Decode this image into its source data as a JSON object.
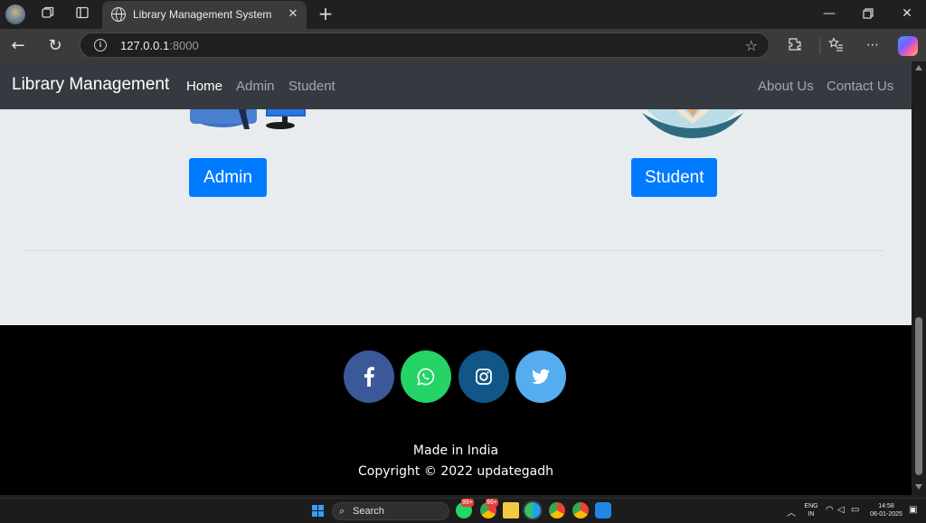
{
  "browser": {
    "tab_title": "Library Management System",
    "url_host": "127.0.0.1",
    "url_port": ":8000"
  },
  "site": {
    "brand": "Library Management",
    "nav_left": [
      "Home",
      "Admin",
      "Student"
    ],
    "nav_right": [
      "About Us",
      "Contact Us"
    ],
    "active_nav": "Home"
  },
  "main": {
    "admin_button": "Admin",
    "student_button": "Student"
  },
  "footer": {
    "social": [
      {
        "name": "facebook",
        "color": "#3b5998"
      },
      {
        "name": "whatsapp",
        "color": "#25d366"
      },
      {
        "name": "instagram",
        "color": "#125688"
      },
      {
        "name": "twitter",
        "color": "#55acee"
      }
    ],
    "made_in": "Made in India",
    "copyright": "Copyright © 2022 updategadh"
  },
  "taskbar": {
    "search_label": "Search",
    "badge_count": "99+",
    "lang_top": "ENG",
    "lang_bottom": "IN",
    "time": "14:58",
    "date": "06-01-2025"
  },
  "colors": {
    "primary": "#007bff",
    "navbar": "#343a40",
    "page_bg": "#e9ecef",
    "footer_bg": "#000000"
  }
}
